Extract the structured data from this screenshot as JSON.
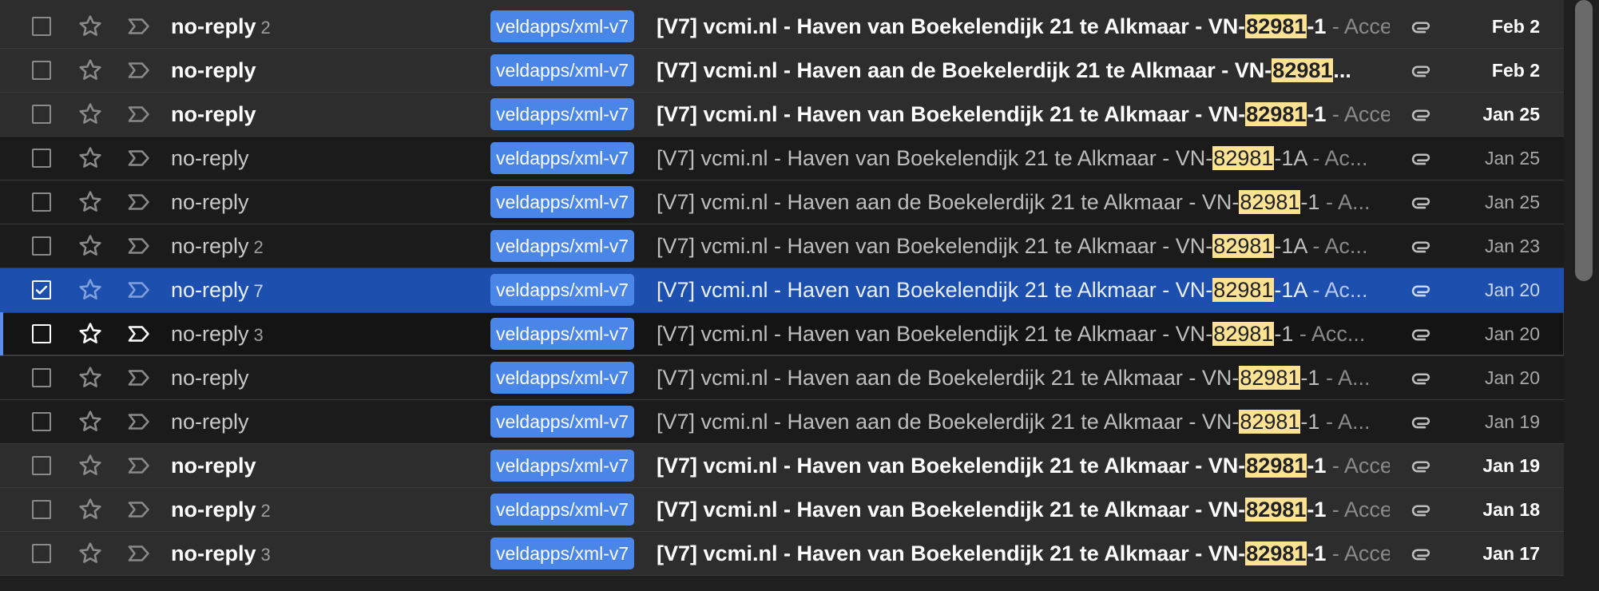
{
  "colors": {
    "label_bg": "#4a86e8",
    "highlight": "#fde293",
    "selected_row": "#1d4fae",
    "focus_bar": "#5a8dee"
  },
  "icons": {
    "checkbox": "checkbox-icon",
    "star": "star-icon",
    "importance": "importance-marker-icon",
    "attachment": "paperclip-icon"
  },
  "highlight_term": "82981",
  "emails": [
    {
      "sender": "no-reply",
      "count": "2",
      "label": "veldapps/xml-v7",
      "subject_pre": "[V7] vcmi.nl - Haven van Boekelendijk 21 te Alkmaar - VN-",
      "subject_hl": "82981",
      "subject_post": "-1",
      "snippet": " - Accepted",
      "date": "Feb 2",
      "unread": true,
      "checked": false
    },
    {
      "sender": "no-reply",
      "count": "",
      "label": "veldapps/xml-v7",
      "subject_pre": "[V7] vcmi.nl - Haven aan de Boekelerdijk 21 te Alkmaar - VN-",
      "subject_hl": "82981",
      "subject_post": "...",
      "snippet": "",
      "date": "Feb 2",
      "unread": true,
      "checked": false
    },
    {
      "sender": "no-reply",
      "count": "",
      "label": "veldapps/xml-v7",
      "subject_pre": "[V7] vcmi.nl - Haven van Boekelendijk 21 te Alkmaar - VN-",
      "subject_hl": "82981",
      "subject_post": "-1",
      "snippet": " - Accepted",
      "date": "Jan 25",
      "unread": true,
      "checked": false
    },
    {
      "sender": "no-reply",
      "count": "",
      "label": "veldapps/xml-v7",
      "subject_pre": "[V7] vcmi.nl - Haven van Boekelendijk 21 te Alkmaar - VN-",
      "subject_hl": "82981",
      "subject_post": "-1A",
      "snippet": " - Ac...",
      "date": "Jan 25",
      "unread": false,
      "checked": false
    },
    {
      "sender": "no-reply",
      "count": "",
      "label": "veldapps/xml-v7",
      "subject_pre": "[V7] vcmi.nl - Haven aan de Boekelerdijk 21 te Alkmaar - VN-",
      "subject_hl": "82981",
      "subject_post": "-1",
      "snippet": " - A...",
      "date": "Jan 25",
      "unread": false,
      "checked": false
    },
    {
      "sender": "no-reply",
      "count": "2",
      "label": "veldapps/xml-v7",
      "subject_pre": "[V7] vcmi.nl - Haven van Boekelendijk 21 te Alkmaar - VN-",
      "subject_hl": "82981",
      "subject_post": "-1A",
      "snippet": " - Ac...",
      "date": "Jan 23",
      "unread": false,
      "checked": false
    },
    {
      "sender": "no-reply",
      "count": "7",
      "label": "veldapps/xml-v7",
      "subject_pre": "[V7] vcmi.nl - Haven van Boekelendijk 21 te Alkmaar - VN-",
      "subject_hl": "82981",
      "subject_post": "-1A",
      "snippet": " - Ac...",
      "date": "Jan 20",
      "unread": false,
      "checked": true,
      "selected": true
    },
    {
      "sender": "no-reply",
      "count": "3",
      "label": "veldapps/xml-v7",
      "subject_pre": "[V7] vcmi.nl - Haven van Boekelendijk 21 te Alkmaar - VN-",
      "subject_hl": "82981",
      "subject_post": "-1",
      "snippet": " - Acc...",
      "date": "Jan 20",
      "unread": false,
      "checked": false,
      "focused": true
    },
    {
      "sender": "no-reply",
      "count": "",
      "label": "veldapps/xml-v7",
      "subject_pre": "[V7] vcmi.nl - Haven aan de Boekelerdijk 21 te Alkmaar - VN-",
      "subject_hl": "82981",
      "subject_post": "-1",
      "snippet": " - A...",
      "date": "Jan 20",
      "unread": false,
      "checked": false
    },
    {
      "sender": "no-reply",
      "count": "",
      "label": "veldapps/xml-v7",
      "subject_pre": "[V7] vcmi.nl - Haven aan de Boekelerdijk 21 te Alkmaar - VN-",
      "subject_hl": "82981",
      "subject_post": "-1",
      "snippet": " - A...",
      "date": "Jan 19",
      "unread": false,
      "checked": false
    },
    {
      "sender": "no-reply",
      "count": "",
      "label": "veldapps/xml-v7",
      "subject_pre": "[V7] vcmi.nl - Haven van Boekelendijk 21 te Alkmaar - VN-",
      "subject_hl": "82981",
      "subject_post": "-1",
      "snippet": " - Accepted",
      "date": "Jan 19",
      "unread": true,
      "checked": false
    },
    {
      "sender": "no-reply",
      "count": "2",
      "label": "veldapps/xml-v7",
      "subject_pre": "[V7] vcmi.nl - Haven van Boekelendijk 21 te Alkmaar - VN-",
      "subject_hl": "82981",
      "subject_post": "-1",
      "snippet": " - Accepted",
      "date": "Jan 18",
      "unread": true,
      "checked": false
    },
    {
      "sender": "no-reply",
      "count": "3",
      "label": "veldapps/xml-v7",
      "subject_pre": "[V7] vcmi.nl - Haven van Boekelendijk 21 te Alkmaar - VN-",
      "subject_hl": "82981",
      "subject_post": "-1",
      "snippet": " - Accepted",
      "date": "Jan 17",
      "unread": true,
      "checked": false
    }
  ]
}
